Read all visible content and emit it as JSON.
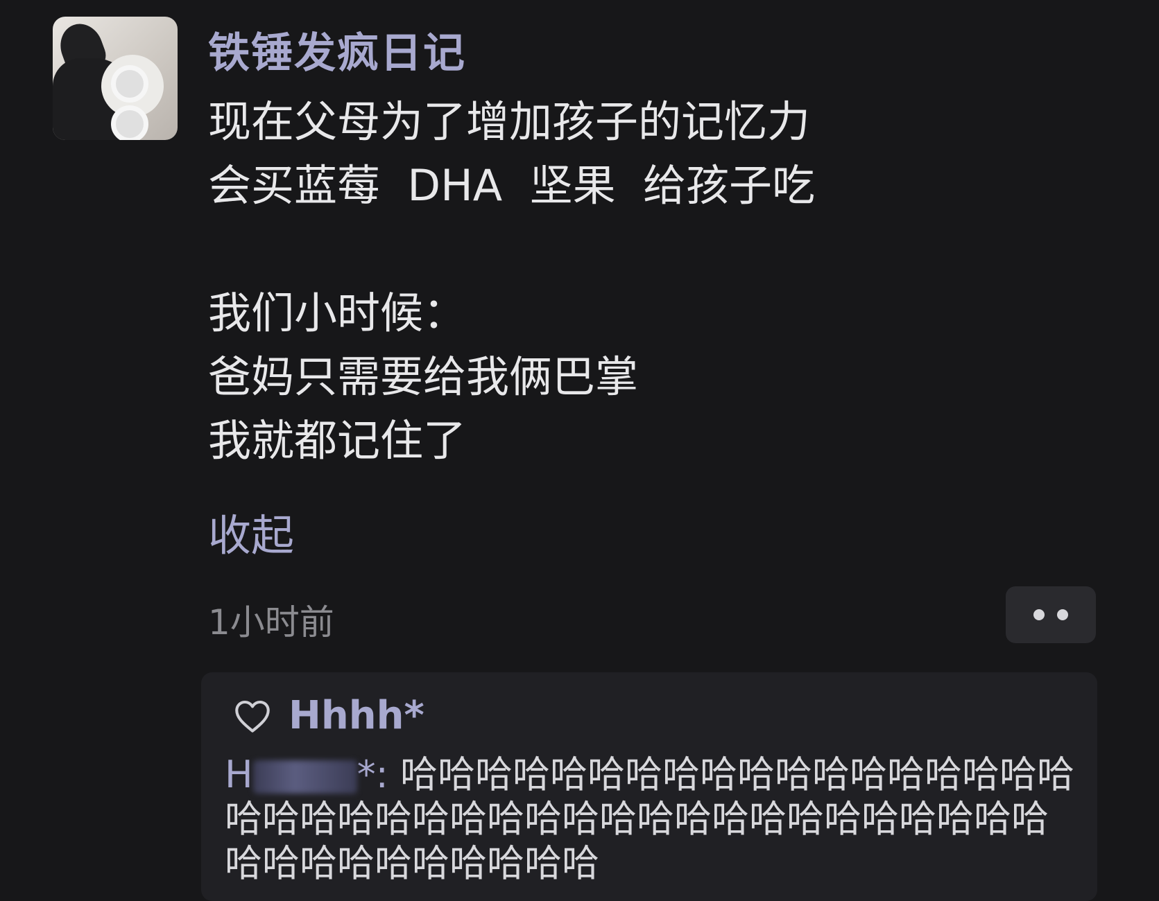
{
  "post": {
    "author": "铁锤发疯日记",
    "lines": [
      "现在父母为了增加孩子的记忆力",
      "会买蓝莓  DHA  坚果  给孩子吃",
      "",
      "我们小时候：",
      "爸妈只需要给我俩巴掌",
      "我就都记住了"
    ],
    "collapse_label": "收起",
    "time": "1小时前"
  },
  "reply": {
    "liker_name": "Hhhh*",
    "commenter_prefix": "H",
    "commenter_suffix": "*:",
    "text": "哈哈哈哈哈哈哈哈哈哈哈哈哈哈哈哈哈哈哈哈哈哈哈哈哈哈哈哈哈哈哈哈哈哈哈哈哈哈哈哈哈哈哈哈哈哈哈哈哈哈"
  },
  "colors": {
    "background": "#171719",
    "accent": "#a8a9cf",
    "text": "#e8e8ea",
    "muted": "#8b8b90"
  }
}
